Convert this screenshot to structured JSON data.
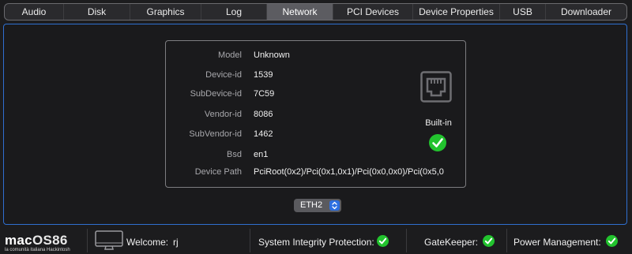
{
  "tabs": [
    {
      "label": "Audio",
      "active": false
    },
    {
      "label": "Disk",
      "active": false
    },
    {
      "label": "Graphics",
      "active": false
    },
    {
      "label": "Log",
      "active": false
    },
    {
      "label": "Network",
      "active": true
    },
    {
      "label": "PCI Devices",
      "active": false
    },
    {
      "label": "Device Properties",
      "active": false
    },
    {
      "label": "USB",
      "active": false
    },
    {
      "label": "Downloader",
      "active": false
    }
  ],
  "device": {
    "model_label": "Model",
    "model_value": "Unknown",
    "device_id_label": "Device-id",
    "device_id_value": "1539",
    "subdevice_id_label": "SubDevice-id",
    "subdevice_id_value": "7C59",
    "vendor_id_label": "Vendor-id",
    "vendor_id_value": "8086",
    "subvendor_id_label": "SubVendor-id",
    "subvendor_id_value": "1462",
    "bsd_label": "Bsd",
    "bsd_value": "en1",
    "device_path_label": "Device Path",
    "device_path_value": "PciRoot(0x2)/Pci(0x1,0x1)/Pci(0x0,0x0)/Pci(0x5,0"
  },
  "builtin": {
    "label": "Built-in",
    "checked": true,
    "icon": "ethernet-port-icon"
  },
  "interface_select": {
    "value": "ETH2"
  },
  "status_bar": {
    "logo_brand_a": "mac",
    "logo_brand_b": "OS86",
    "logo_tagline": "la comunità italiana Hackintosh",
    "welcome_label": "Welcome:",
    "user": "rj",
    "sip_label": "System Integrity Protection:",
    "gatekeeper_label": "GateKeeper:",
    "power_label": "Power Management:"
  },
  "colors": {
    "accent": "#2f6fd0",
    "check_green": "#22c32e",
    "active_tab": "#5c5c61"
  }
}
